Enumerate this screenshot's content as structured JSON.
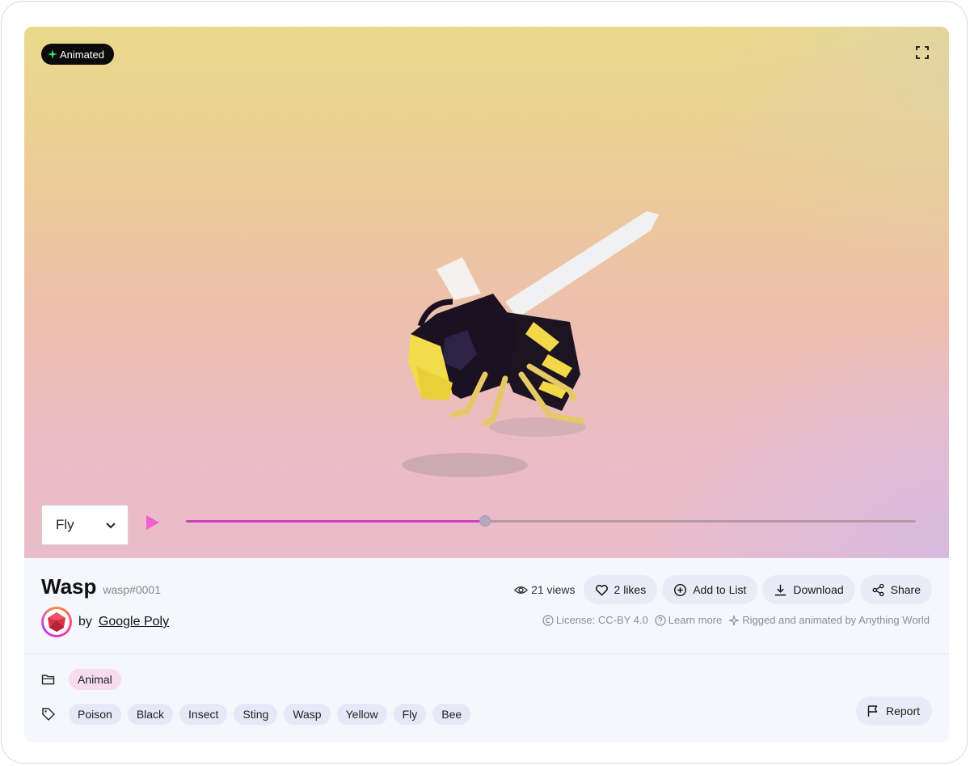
{
  "viewer": {
    "badge_label": "Animated",
    "animation_select": {
      "selected": "Fly"
    },
    "progress": 0.41,
    "colors": {
      "progress_fill": "#d13ec0",
      "play": "#f25fd0",
      "badge_bg": "#0b0b0b",
      "badge_icon": "#39e07a"
    }
  },
  "model": {
    "title": "Wasp",
    "id": "wasp#0001",
    "author_prefix": "by",
    "author_name": "Google Poly"
  },
  "actions": {
    "views": "21 views",
    "likes": "2 likes",
    "add_to_list": "Add to List",
    "download": "Download",
    "share": "Share"
  },
  "meta": {
    "license": "License: CC-BY 4.0",
    "learn_more": "Learn more",
    "rigged_by": "Rigged and animated by Anything World"
  },
  "category": "Animal",
  "tags": [
    "Poison",
    "Black",
    "Insect",
    "Sting",
    "Wasp",
    "Yellow",
    "Fly",
    "Bee"
  ],
  "report_label": "Report",
  "icons": [
    "sparkle-icon",
    "fullscreen-icon",
    "chevron-down-icon",
    "play-icon",
    "eye-icon",
    "heart-icon",
    "plus-circle-icon",
    "download-icon",
    "share-icon",
    "copyright-icon",
    "help-circle-icon",
    "sparkle-outline-icon",
    "folder-icon",
    "tag-icon",
    "flag-icon"
  ]
}
